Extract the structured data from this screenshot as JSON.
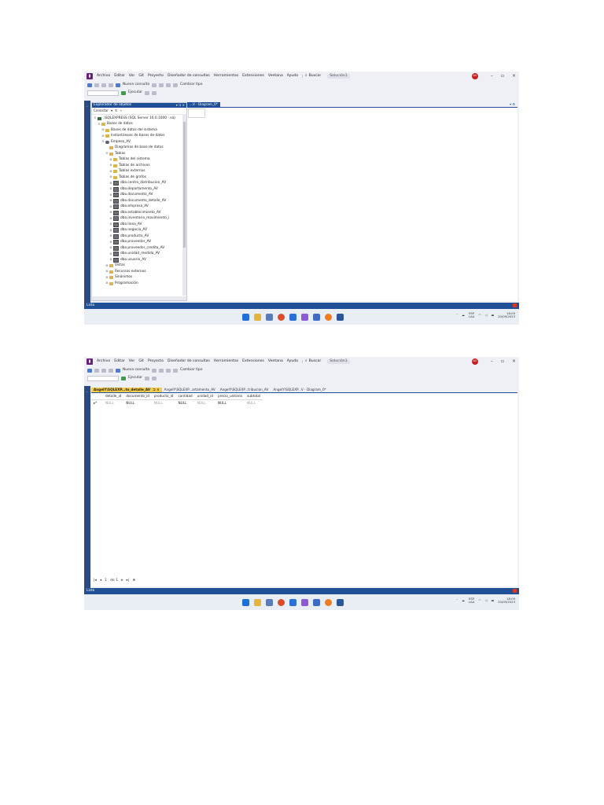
{
  "menu": {
    "items": [
      "Archivo",
      "Editar",
      "Ver",
      "Git",
      "Proyecto",
      "Diseñador de consultas",
      "Herramientas",
      "Extensiones",
      "Ventana",
      "Ayuda"
    ],
    "search": "Buscar",
    "solution": "Solución1",
    "avatar": "AO"
  },
  "toolbar": {
    "new_query": "Nueva consulta",
    "execute": "Ejecutar",
    "change_type": "Cambiar tipo"
  },
  "explorer": {
    "title": "Explorador de objetos",
    "connect": "Conectar",
    "tree": [
      {
        "level": 0,
        "icon": "server",
        "exp": "⊟",
        "label": ".\\SQLEXPRESS (SQL Server 16.0.1000 - sa)"
      },
      {
        "level": 1,
        "icon": "folder",
        "exp": "⊟",
        "label": "Bases de datos"
      },
      {
        "level": 2,
        "icon": "folder",
        "exp": "⊞",
        "label": "Bases de datos del sistema"
      },
      {
        "level": 2,
        "icon": "folder",
        "exp": "⊞",
        "label": "Instantáneas de bases de datos"
      },
      {
        "level": 2,
        "icon": "db",
        "exp": "⊟",
        "label": "Empesa_AV"
      },
      {
        "level": 3,
        "icon": "folder",
        "exp": "",
        "label": "Diagramas de base de datos"
      },
      {
        "level": 3,
        "icon": "folder",
        "exp": "⊟",
        "label": "Tablas"
      },
      {
        "level": 4,
        "icon": "folder",
        "exp": "⊞",
        "label": "Tablas del sistema"
      },
      {
        "level": 4,
        "icon": "folder",
        "exp": "⊞",
        "label": "Tablas de archivos"
      },
      {
        "level": 4,
        "icon": "folder",
        "exp": "⊞",
        "label": "Tablas externas"
      },
      {
        "level": 4,
        "icon": "folder",
        "exp": "⊞",
        "label": "Tablas de grafos"
      },
      {
        "level": 4,
        "icon": "table",
        "exp": "⊞",
        "label": "dbo.centro_distribucion_AV"
      },
      {
        "level": 4,
        "icon": "table",
        "exp": "⊞",
        "label": "dbo.departamento_AV"
      },
      {
        "level": 4,
        "icon": "table",
        "exp": "⊞",
        "label": "dbo.documento_AV"
      },
      {
        "level": 4,
        "icon": "table",
        "exp": "⊞",
        "label": "dbo.documento_detalle_AV"
      },
      {
        "level": 4,
        "icon": "table",
        "exp": "⊞",
        "label": "dbo.empresa_AV"
      },
      {
        "level": 4,
        "icon": "table",
        "exp": "⊞",
        "label": "dbo.establecimiento_AV"
      },
      {
        "level": 4,
        "icon": "table",
        "exp": "⊞",
        "label": "dbo.inventario_movimiento_i"
      },
      {
        "level": 4,
        "icon": "table",
        "exp": "⊞",
        "label": "dbo.linea_AV"
      },
      {
        "level": 4,
        "icon": "table",
        "exp": "⊞",
        "label": "dbo.negocio_AV"
      },
      {
        "level": 4,
        "icon": "table",
        "exp": "⊞",
        "label": "dbo.producto_AV"
      },
      {
        "level": 4,
        "icon": "table",
        "exp": "⊞",
        "label": "dbo.proveedor_AV"
      },
      {
        "level": 4,
        "icon": "table",
        "exp": "⊞",
        "label": "dbo.proveedor_credito_AV"
      },
      {
        "level": 4,
        "icon": "table",
        "exp": "⊞",
        "label": "dbo.unidad_medida_AV"
      },
      {
        "level": 4,
        "icon": "table",
        "exp": "⊞",
        "label": "dbo.usuario_AV"
      },
      {
        "level": 3,
        "icon": "folder",
        "exp": "⊞",
        "label": "Vistas"
      },
      {
        "level": 3,
        "icon": "folder",
        "exp": "⊞",
        "label": "Recursos externos"
      },
      {
        "level": 3,
        "icon": "folder",
        "exp": "⊞",
        "label": "Sinónimos"
      },
      {
        "level": 3,
        "icon": "folder",
        "exp": "⊞",
        "label": "Programación"
      }
    ]
  },
  "shot1": {
    "doc_tab": "...V - Diagram_0*",
    "status": "Listo"
  },
  "shot2": {
    "tabs": [
      {
        "label": "AngelY\\SQLEXP...to_detalle_AV",
        "active": true
      },
      {
        "label": "AngelY\\SQLEXP...artamento_AV",
        "active": false
      },
      {
        "label": "AngelY\\SQLEXP...tribucion_AV",
        "active": false
      },
      {
        "label": "AngelY\\SQLEXP...V - Diagram_0*",
        "active": false
      }
    ],
    "columns": [
      "detalle_id",
      "documento_id",
      "producto_id",
      "cantidad",
      "unidad_id",
      "precio_unitario",
      "subtotal"
    ],
    "row_marker": "▸*",
    "row_values": [
      "NULL",
      "NULL",
      "NULL",
      "NULL",
      "NULL",
      "NULL",
      "NULL"
    ],
    "nav_first": "|◂",
    "nav_prev": "◂",
    "nav_page": "1",
    "nav_of": "de 1",
    "nav_next": "▸",
    "nav_last": "▸|",
    "status": "Listo"
  },
  "taskbar": {
    "lang_top": "ESP",
    "lang_bottom": "LAA",
    "time": "18:09",
    "date": "20/09/2023"
  }
}
